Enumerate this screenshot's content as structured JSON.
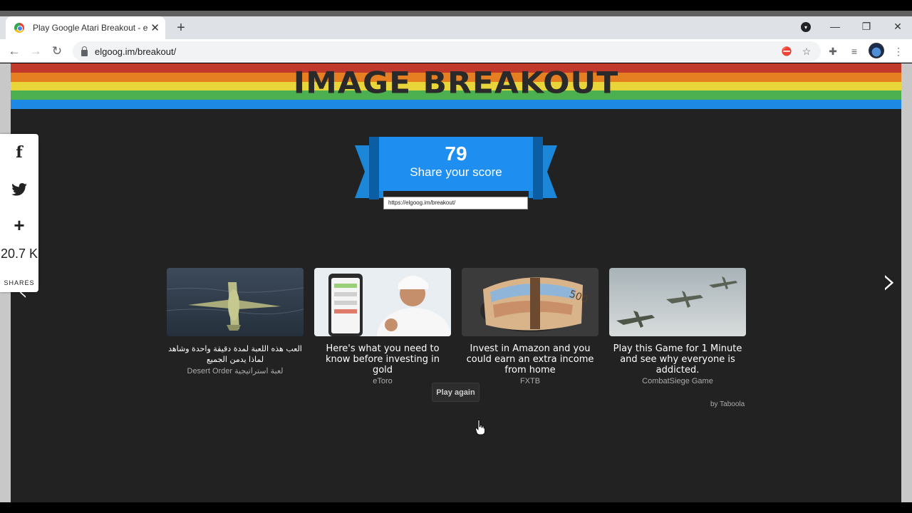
{
  "browser": {
    "tab_title": "Play Google Atari Breakout - elgoog",
    "new_tab_symbol": "+",
    "url": "elgoog.im/breakout/"
  },
  "banner": {
    "title": "IMAGE BREAKOUT",
    "stripe_colors": [
      "#c0392b",
      "#e67e22",
      "#e8d53a",
      "#4caf50",
      "#1e88e5"
    ]
  },
  "score_card": {
    "score": "79",
    "label": "Share your score",
    "share_url": "https://elgoog.im/breakout/"
  },
  "social": {
    "count": "20.7 K",
    "label": "SHARES",
    "icons": [
      "facebook-icon",
      "twitter-icon",
      "plus-icon"
    ]
  },
  "recommendations": [
    {
      "title": "العب هذه اللعبة لمدة دقيقة واحدة وشاهد لماذا يدمن الجميع",
      "source": "Desert Order لعبة استراتيجية",
      "image": "aircraft-over-sea"
    },
    {
      "title": "Here's what you need to know before investing in gold",
      "source": "eToro",
      "image": "man-with-phone"
    },
    {
      "title": "Invest in Amazon and you could earn an extra income from home",
      "source": "FXTB",
      "image": "money-roll"
    },
    {
      "title": "Play this Game for 1 Minute and see why everyone is addicted.",
      "source": "CombatSiege Game",
      "image": "jets-in-sky"
    }
  ],
  "taboola_label": "by Taboola",
  "play_again_label": "Play again"
}
